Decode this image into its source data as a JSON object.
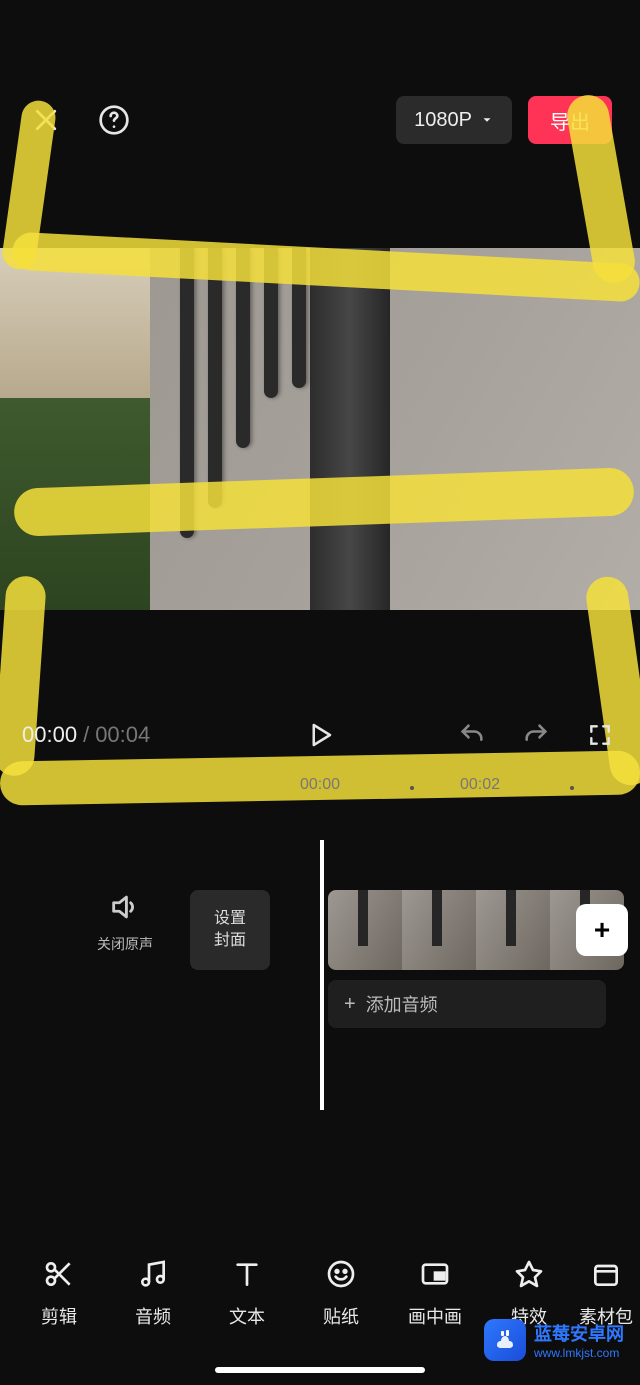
{
  "topbar": {
    "resolution_label": "1080P",
    "export_label": "导出"
  },
  "playback": {
    "current": "00:00",
    "separator": "/",
    "duration": "00:04"
  },
  "ticks": {
    "t0": "00:00",
    "t2": "00:02"
  },
  "timeline": {
    "mute_label": "关闭原声",
    "cover_label_line1": "设置",
    "cover_label_line2": "封面",
    "add_audio_label": "添加音频",
    "plus": "+"
  },
  "bottom_tools": [
    {
      "id": "edit",
      "icon": "scissors-icon",
      "label": "剪辑"
    },
    {
      "id": "audio",
      "icon": "music-icon",
      "label": "音频"
    },
    {
      "id": "text",
      "icon": "text-icon",
      "label": "文本"
    },
    {
      "id": "sticker",
      "icon": "sticker-icon",
      "label": "贴纸"
    },
    {
      "id": "pip",
      "icon": "pip-icon",
      "label": "画中画"
    },
    {
      "id": "effect",
      "icon": "star-icon",
      "label": "特效"
    },
    {
      "id": "material",
      "icon": "material-icon",
      "label": "素材包"
    }
  ],
  "watermark": {
    "title": "蓝莓安卓网",
    "url": "www.lmkjst.com"
  }
}
